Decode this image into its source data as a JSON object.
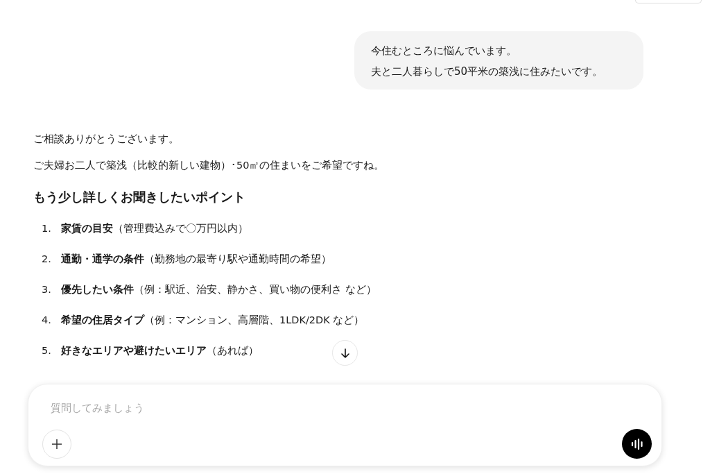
{
  "user_message": {
    "lines": [
      "今住むところに悩んでいます。",
      "夫と二人暮らしで50平米の築浅に住みたいです。"
    ]
  },
  "assistant_message": {
    "paragraphs": [
      "ご相談ありがとうございます。",
      "ご夫婦お二人で築浅（比較的新しい建物）･50㎡の住まいをご希望ですね。"
    ],
    "heading": "もう少し詳しくお聞きしたいポイント",
    "items": [
      {
        "number": "1.",
        "text": "**家賃の目安**（管理費込みで〇万円以内）"
      },
      {
        "number": "2.",
        "text": "**通勤・通学の条件**（勤務地の最寄り駅や通勤時間の希望）"
      },
      {
        "number": "3.",
        "text": "**優先したい条件**（例：駅近、治安、静かさ、買い物の便利さ など）"
      },
      {
        "number": "4.",
        "text": "**希望の住居タイプ**（例：マンション、高層階、1LDK/2DK など）"
      },
      {
        "number": "5.",
        "text": "**好きなエリアや避けたいエリア**（あれば）"
      }
    ]
  },
  "composer": {
    "placeholder": "質問してみましょう"
  }
}
